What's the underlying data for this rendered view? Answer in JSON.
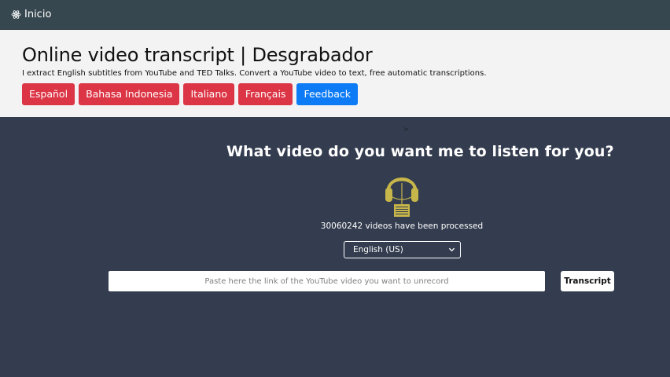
{
  "nav": {
    "brand_label": "Inicio",
    "brand_icon": "atom-icon"
  },
  "hero": {
    "title": "Online video transcript | Desgrabador",
    "subtitle": "I extract English subtitles from YouTube and TED Talks. Convert a YouTube video to text, free automatic transcriptions.",
    "languages": [
      "Español",
      "Bahasa Indonesia",
      "Italiano",
      "Français"
    ],
    "feedback_label": "Feedback"
  },
  "main": {
    "dot": ">",
    "question": "What video do you want me to listen for you?",
    "illustration_icon": "headphones-icon",
    "counter_text": "30060242 videos have been processed",
    "language_select": {
      "selected": "English (US)"
    },
    "url_input": {
      "value": "",
      "placeholder": "Paste here the link of the YouTube video you want to unrecord"
    },
    "transcript_label": "Transcript"
  },
  "colors": {
    "background": "#343d4f",
    "nav": "#36474f",
    "hero": "#f3f3f3",
    "language_button": "#dc3545",
    "feedback_button": "#0d7bf5",
    "headphones": "#c7b64a"
  }
}
